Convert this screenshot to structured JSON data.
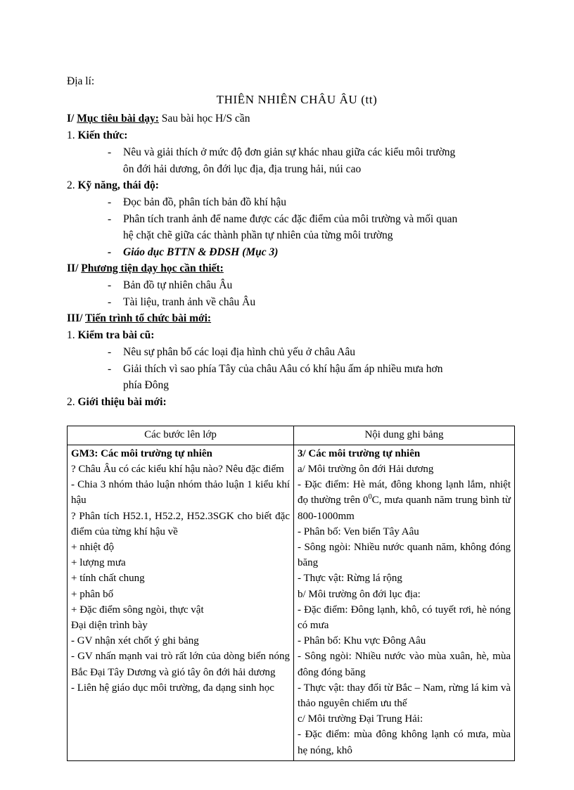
{
  "document": {
    "subject": "Địa lí:",
    "title": "THIÊN  NHIÊN CHÂU ÂU (tt)",
    "sections": [
      {
        "id": "muc-tieu",
        "prefix": "I/",
        "heading": "Mục tiêu bài dạy:",
        "trailing": " Sau bài học H/S cần"
      }
    ],
    "sub1": {
      "number": "1.",
      "heading": "Kiến thức:",
      "bullets": [
        {
          "dash": "-",
          "lines": [
            "Nêu và  giải thích ở mức độ đơn giản sự khác nhau  giữa các kiểu môi trường",
            "ôn đới hải dương,  ôn đới lục địa, địa trung hải, núi cao"
          ]
        }
      ]
    },
    "sub2": {
      "number": "2.",
      "heading": "Kỹ năng, thái độ:",
      "bullets": [
        {
          "dash": "-",
          "lines": [
            "Đọc bản đồ, phân tích bản đồ khí hậu"
          ]
        },
        {
          "dash": "-",
          "lines": [
            "Phân tích tranh ảnh để name được các đặc điểm của môi trường và mối quan",
            "hệ chặt chẽ giữa các thành phần tự nhiên của từng môi trường"
          ]
        },
        {
          "dash": "-",
          "bold_italic": true,
          "lines": [
            "Giáo dục BTTN  & ĐDSH  (Mục 3)"
          ]
        }
      ]
    },
    "section2": {
      "prefix": "II/",
      "heading": "Phương tiện dạy học cần thiết:",
      "bullets": [
        {
          "dash": "-",
          "lines": [
            "Bản đồ tự nhiên châu Âu"
          ]
        },
        {
          "dash": "-",
          "lines": [
            "Tài liệu, tranh ảnh về châu Âu"
          ]
        }
      ]
    },
    "section3": {
      "prefix": "III/",
      "heading": "Tiến trình tổ chức bài mới:"
    },
    "sub3": {
      "number": "1.",
      "heading": "Kiểm tra bài cũ:",
      "bullets": [
        {
          "dash": "-",
          "lines": [
            "Nêu sự phân bố các loại địa hình chủ yếu ở châu Aâu"
          ]
        },
        {
          "dash": "-",
          "lines": [
            "Giải thích vì sao phía Tây  của châu Aâu  có khí hậu ấm áp nhiều mưa hơn",
            "phía Đông"
          ]
        }
      ]
    },
    "sub4": {
      "number": "2.",
      "heading": "Giới thiệu bài mới:"
    }
  },
  "table": {
    "headers": [
      "Các bước lên lớp",
      "Nội dung ghi bảng"
    ],
    "left_column": [
      {
        "text": "GM3: Các môi trường tự nhiên",
        "bold": true,
        "justify": false
      },
      {
        "text": "? Châu Âu có các kiểu khí hậu nào? Nêu đặc điểm",
        "bold": false,
        "justify": true
      },
      {
        "text": "- Chia 3 nhóm thảo luận nhóm thảo luận 1 kiểu khí hậu",
        "bold": false,
        "justify": true
      },
      {
        "text": "? Phân tích H52.1, H52.2, H52.3SGK cho biết đặc điểm của từng khí hậu về",
        "bold": false,
        "justify": true
      },
      {
        "text": "+ nhiệt độ",
        "bold": false,
        "justify": false
      },
      {
        "text": "+ lượng mưa",
        "bold": false,
        "justify": false
      },
      {
        "text": "+ tính chất chung",
        "bold": false,
        "justify": false
      },
      {
        "text": "+ phân bố",
        "bold": false,
        "justify": false
      },
      {
        "text": "+ Đặc điểm sông ngòi, thực vật",
        "bold": false,
        "justify": false
      },
      {
        "text": "Đại diện trình bày",
        "bold": false,
        "justify": false
      },
      {
        "text": "- GV nhận xét chốt ý ghi bảng",
        "bold": false,
        "justify": false
      },
      {
        "text": "- GV nhấn mạnh vai trò rất lớn của dòng biển nóng Bắc Đại Tây Dương và gió tây ôn đới hải dương",
        "bold": false,
        "justify": true
      },
      {
        "text": "- Liên hệ giáo dục môi trường, đa dạng sinh học",
        "bold": false,
        "justify": true
      }
    ],
    "right_column": [
      {
        "text": "3/ Các môi trường tự nhiên",
        "bold": true,
        "justify": false
      },
      {
        "text": "a/ Môi trường ôn đới Hải dương",
        "bold": false,
        "justify": false
      },
      {
        "text": "- Đặc điểm: Hè mát, đông khong lạnh lắm, nhiệt đọ thường trên 0°C, mưa quanh năm trung bình từ 800-1000mm",
        "bold": false,
        "justify": true,
        "superscript": {
          "after": "nhiệt đọ thường trên 0",
          "sup": "0",
          "rest": "C, mưa quanh năm trung bình từ 800-1000mm"
        }
      },
      {
        "text": "- Phân bố: Ven biển Tây Aâu",
        "bold": false,
        "justify": false
      },
      {
        "text": "- Sông ngòi: Nhiều nước quanh năm, không đóng băng",
        "bold": false,
        "justify": true
      },
      {
        "text": "- Thực vật: Rừng lá rộng",
        "bold": false,
        "justify": false
      },
      {
        "text": "b/ Môi trường ôn đới lục địa:",
        "bold": false,
        "justify": false
      },
      {
        "text": "- Đặc điểm: Đông lạnh, khô, có tuyết rơi, hè nóng có mưa",
        "bold": false,
        "justify": true
      },
      {
        "text": "- Phân bố: Khu vực Đông Aâu",
        "bold": false,
        "justify": false
      },
      {
        "text": "- Sông ngòi: Nhiều nước vào mùa xuân, hè, mùa đông đóng băng",
        "bold": false,
        "justify": true
      },
      {
        "text": "- Thực vật: thay đổi từ Bắc – Nam, rừng lá kim và thảo nguyên chiếm ưu thế",
        "bold": false,
        "justify": true
      },
      {
        "text": "c/ Môi trường Đại Trung Hải:",
        "bold": false,
        "justify": false
      },
      {
        "text": "- Đặc điểm: mùa đông không lạnh có mưa, mùa hẹ nóng, khô",
        "bold": false,
        "justify": true
      }
    ]
  }
}
